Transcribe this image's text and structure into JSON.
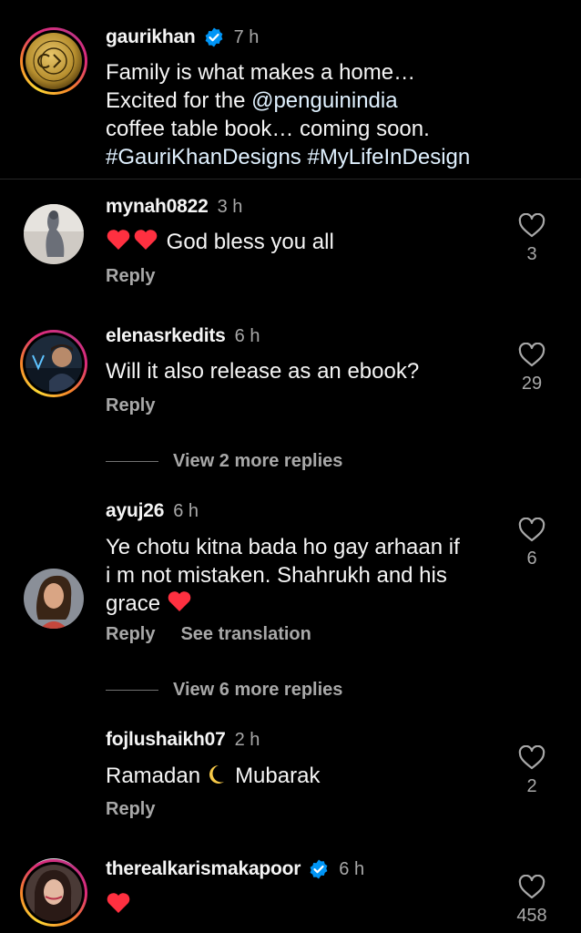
{
  "caption": {
    "username": "gaurikhan",
    "time": "7 h",
    "line1": "Family is what makes a home…",
    "line2_prefix": "Excited for the ",
    "mention": "@penguinindia",
    "line3": "coffee table book… coming soon.",
    "hashtag1": "#GauriKhanDesigns",
    "hashtag2": "#MyLifeInDesign"
  },
  "comments": [
    {
      "username": "mynah0822",
      "time": "3 h",
      "text": "God bless you all",
      "reply": "Reply",
      "likes": "3"
    },
    {
      "username": "elenasrkedits",
      "time": "6 h",
      "text": "Will it also release as an ebook?",
      "reply": "Reply",
      "likes": "29",
      "more_replies": "View 2 more replies"
    },
    {
      "username": "ayuj26",
      "time": "6 h",
      "line1": "Ye chotu kitna bada ho gay arhaan if",
      "line2": "i m not mistaken. Shahrukh and his",
      "line3": "grace",
      "reply": "Reply",
      "translate": "See translation",
      "likes": "6",
      "more_replies": "View 6 more replies"
    },
    {
      "username": "fojlushaikh07",
      "time": "2 h",
      "text_before": "Ramadan",
      "text_after": "Mubarak",
      "reply": "Reply",
      "likes": "2"
    },
    {
      "username": "therealkarismakapoor",
      "time": "6 h",
      "likes": "458"
    }
  ],
  "colors": {
    "background": "#000000",
    "text": "#f5f5f5",
    "muted": "#a8a8a8",
    "verified": "#0095f6",
    "heart": "#ff3040"
  },
  "icons": {
    "verified": "verified-badge-icon",
    "like": "heart-outline-icon"
  }
}
